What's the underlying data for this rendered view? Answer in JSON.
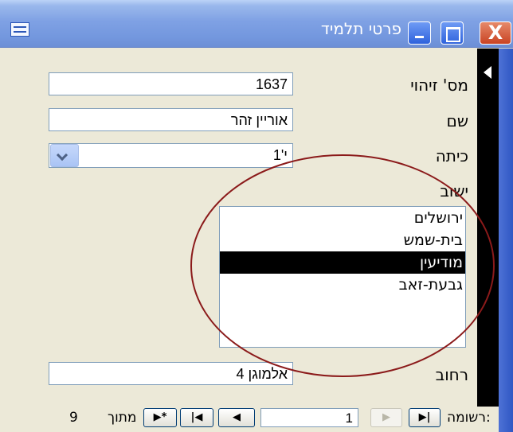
{
  "window": {
    "title": "פרטי תלמיד",
    "close_glyph": "X"
  },
  "fields": {
    "id_label": "מס' זיהוי",
    "id_value": "1637",
    "name_label": "שם",
    "name_value": "אוריין זהר",
    "class_label": "כיתה",
    "class_value": "י'1",
    "settlement_label": "ישוב",
    "street_label": "רחוב",
    "street_value": "אלמוגן 4"
  },
  "settlement_list": {
    "items": [
      "ירושלים",
      "בית-שמש",
      "מודיעין",
      "גבעת-זאב"
    ],
    "selected": "מודיעין"
  },
  "navigation": {
    "record_label": "רשומה:",
    "current_record": "1",
    "of_label": "מתוך",
    "total_records": "9",
    "btn_last": "▶|",
    "btn_next": "▶",
    "btn_prev": "◀",
    "btn_first": "|◀",
    "btn_new": "▶*"
  },
  "colors": {
    "annotation_ellipse": "#8b1a1a",
    "title_bar": "#7397de",
    "form_background": "#ece9d8"
  },
  "icons": [
    "form-icon",
    "minimize-icon",
    "maximize-icon",
    "close-icon",
    "record-selector-arrow-icon",
    "dropdown-chevron-icon"
  ]
}
